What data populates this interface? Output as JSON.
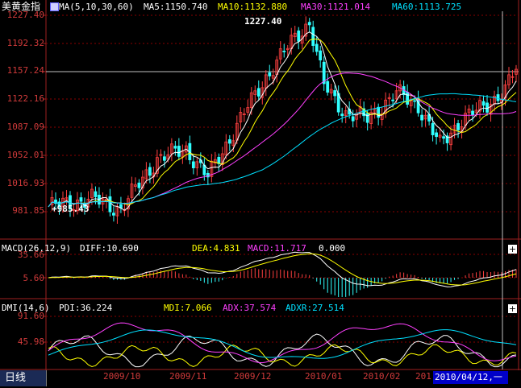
{
  "main_panel": {
    "title": "美黄金指",
    "ma_params": "MA(5,10,30,60)",
    "ma5": "MA5:1150.740",
    "ma10": "MA10:1132.880",
    "ma30": "MA30:1121.014",
    "ma60": "MA60:1113.725",
    "y_ticks": [
      "1227.40",
      "1192.32",
      "1157.24",
      "1122.16",
      "1087.09",
      "1052.01",
      "1016.93",
      "981.85"
    ],
    "high_annotation": "1227.40",
    "low_annotation": "+985.43"
  },
  "macd_panel": {
    "params": "MACD(26,12,9)",
    "diff": "DIFF:10.690",
    "dea": "DEA:4.831",
    "macd": "MACD:11.717",
    "extra": "0.000",
    "y_ticks": [
      "35.66",
      "5.60"
    ]
  },
  "dmi_panel": {
    "params": "DMI(14,6)",
    "pdi": "PDI:36.224",
    "mdi": "MDI:7.066",
    "adx": "ADX:37.574",
    "adxr": "ADXR:27.514",
    "y_ticks": [
      "91.60",
      "45.98"
    ]
  },
  "x_axis": {
    "labels": [
      "2009/10",
      "2009/11",
      "2009/12",
      "2010/01",
      "2010/02",
      "201"
    ]
  },
  "period_tab": "日线",
  "cursor_date": "2010/04/12,一",
  "colors": {
    "up": "#ff4040",
    "down": "#30ffff",
    "ma5": "#ffffff",
    "ma10": "#ffff00",
    "ma30": "#ff40ff",
    "ma60": "#00e0ff",
    "grid": "#8b0000",
    "axis": "#d03a3a"
  },
  "chart_data": {
    "type": "candlestick",
    "price_range": [
      960,
      1232
    ],
    "price_high": 1227.4,
    "price_low": 985.43
  }
}
